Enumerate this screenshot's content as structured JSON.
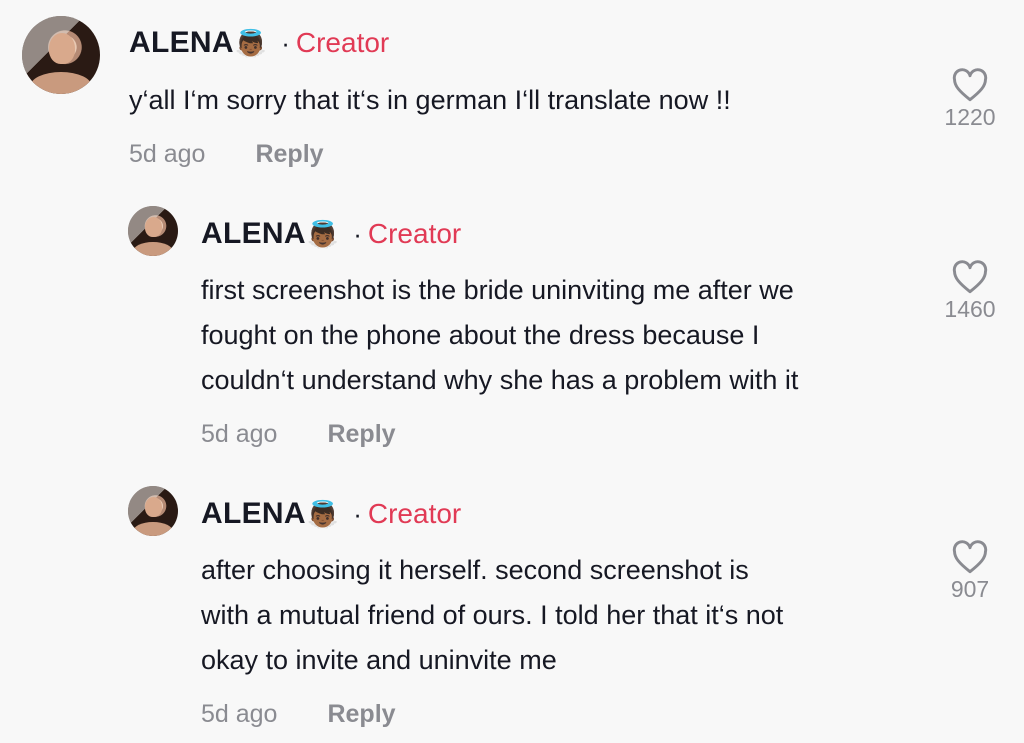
{
  "comments": [
    {
      "author": "ALENA",
      "badge_emoji": "👼🏾",
      "separator": "·",
      "creator_label": "Creator",
      "text": "y‘all I‘m sorry that it‘s in german I‘ll translate now !!",
      "time": "5d ago",
      "reply_label": "Reply",
      "likes": "1220"
    },
    {
      "author": "ALENA",
      "badge_emoji": "👼🏾",
      "separator": "·",
      "creator_label": "Creator",
      "text_lines": [
        "first screenshot is the bride uninviting me after we",
        "fought on the phone about the dress because I",
        "couldn‘t understand why she has a problem with it"
      ],
      "time": "5d ago",
      "reply_label": "Reply",
      "likes": "1460"
    },
    {
      "author": "ALENA",
      "badge_emoji": "👼🏾",
      "separator": "·",
      "creator_label": "Creator",
      "text_lines": [
        "after choosing it herself. second screenshot is",
        "with a mutual friend of ours. I told her that it‘s not",
        "okay to invite and uninvite me"
      ],
      "time": "5d ago",
      "reply_label": "Reply",
      "likes": "907"
    }
  ],
  "colors": {
    "creator": "#e13a55",
    "muted": "#8a8b91",
    "text": "#161823",
    "background": "#f8f8f8"
  },
  "icons": {
    "like": "heart-outline-icon",
    "avatar": "profile-photo"
  }
}
